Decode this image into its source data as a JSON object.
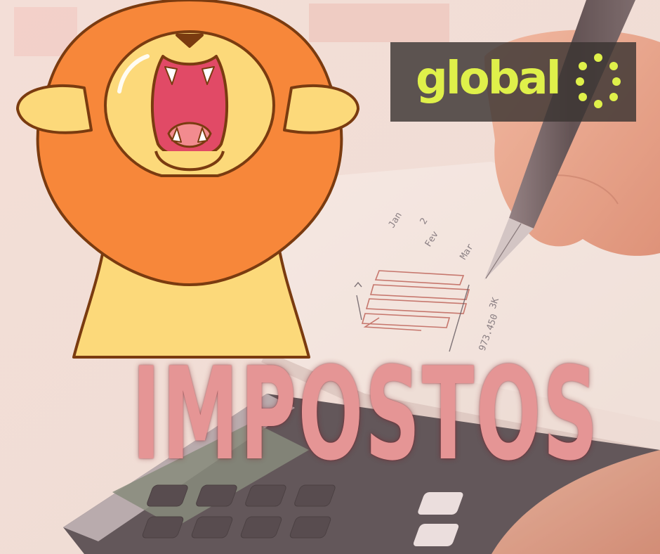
{
  "brand": {
    "name": "global",
    "accent_color": "#dff04a",
    "panel_color": "#3a3432"
  },
  "headline": {
    "text": "IMPOSTOS",
    "color": "#e59595"
  },
  "mascot": {
    "icon": "lion-roaring-icon"
  },
  "photo": {
    "notebook_notes": [
      "Jan",
      "Fev",
      "Mar",
      "2",
      "3K",
      "973.450"
    ]
  }
}
